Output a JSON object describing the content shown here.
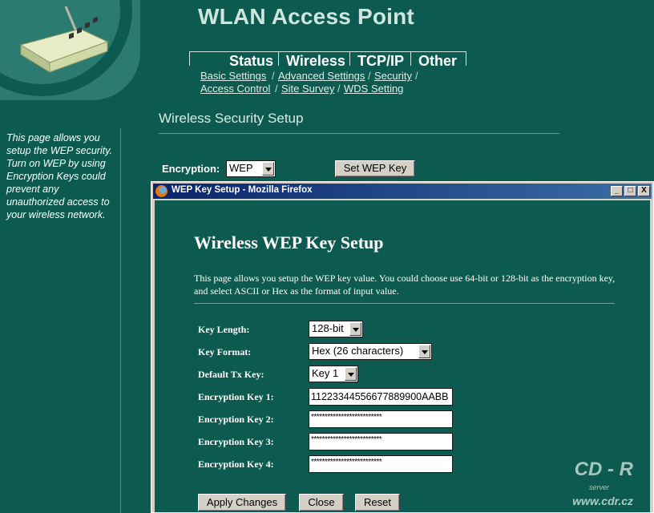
{
  "header": {
    "title": "WLAN Access Point",
    "nav_tabs": [
      "Status",
      "Wireless",
      "TCP/IP",
      "Other"
    ],
    "sub_nav": [
      "Basic Settings",
      "Advanced Settings",
      "Security",
      "Access Control",
      "Site Survey",
      "WDS Setting"
    ]
  },
  "page": {
    "heading": "Wireless Security Setup",
    "sidebar_text": "This page allows you setup the WEP security. Turn on WEP by using Encryption Keys could prevent any unauthorized access to your wireless network.",
    "encryption_label": "Encryption:",
    "encryption_value": "WEP",
    "set_wep_key_label": "Set WEP Key"
  },
  "popup": {
    "window_title": "WEP Key Setup - Mozilla Firefox",
    "minimize": "_",
    "maximize": "□",
    "close": "X",
    "heading": "Wireless WEP Key Setup",
    "description": "This page allows you setup the WEP key value. You could choose use 64-bit or 128-bit as the encryption key, and select ASCII or Hex as the format of input value.",
    "fields": {
      "key_length_label": "Key Length:",
      "key_length_value": "128-bit",
      "key_format_label": "Key Format:",
      "key_format_value": "Hex (26 characters)",
      "default_tx_label": "Default Tx Key:",
      "default_tx_value": "Key 1",
      "key1_label": "Encryption Key 1:",
      "key1_value": "11223344556677889900AABB",
      "key2_label": "Encryption Key 2:",
      "key2_value": "**************************",
      "key3_label": "Encryption Key 3:",
      "key3_value": "**************************",
      "key4_label": "Encryption Key 4:",
      "key4_value": "**************************"
    },
    "buttons": {
      "apply": "Apply Changes",
      "close": "Close",
      "reset": "Reset"
    }
  },
  "watermark": {
    "brand": "CD - R",
    "sub": "server",
    "url": "www.cdr.cz"
  }
}
